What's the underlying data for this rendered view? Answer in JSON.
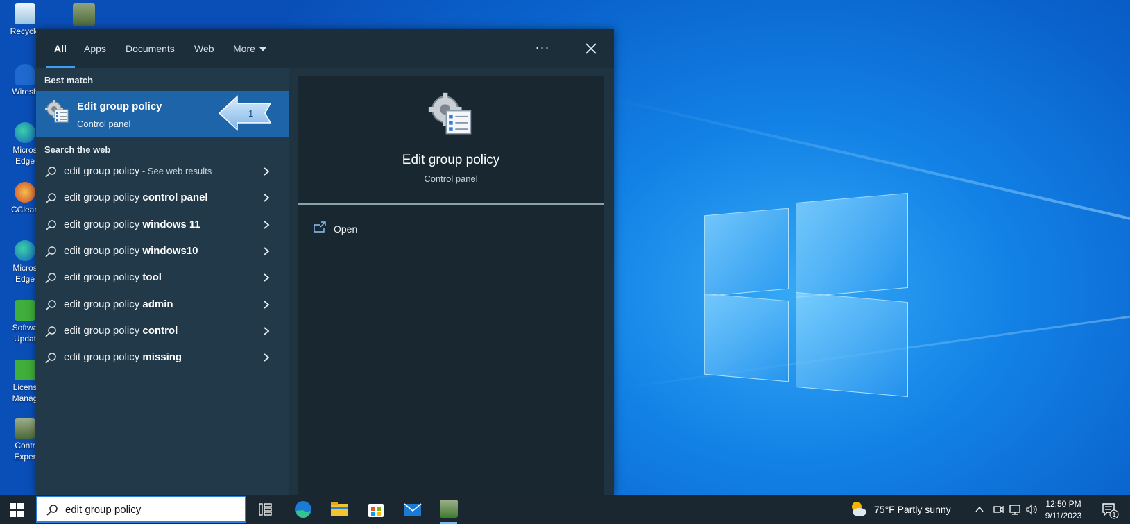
{
  "desktop": {
    "icons": [
      {
        "label": "Recycle",
        "color": "#cfe6f7"
      },
      {
        "label": "Wiresh",
        "color": "#1e6ad0"
      },
      {
        "label": "Micros Edge",
        "color": "#1fa57a"
      },
      {
        "label": "CClean",
        "color": "#d2452d"
      },
      {
        "label": "Micros Edge",
        "color": "#1fa57a"
      },
      {
        "label": "Softwa Updat",
        "color": "#3fae3a"
      },
      {
        "label": "Licens Manag",
        "color": "#3fae3a"
      },
      {
        "label": "Contr Exper",
        "color": "#6b8a5a"
      }
    ]
  },
  "start_menu": {
    "tabs": [
      {
        "label": "All",
        "active": true
      },
      {
        "label": "Apps"
      },
      {
        "label": "Documents"
      },
      {
        "label": "Web"
      },
      {
        "label": "More"
      }
    ],
    "more_icon": "ellipsis-icon",
    "close_icon": "close-icon",
    "best_match_header": "Best match",
    "best_match": {
      "title": "Edit group policy",
      "subtitle": "Control panel",
      "icon": "group-policy-icon",
      "callout_number": "1"
    },
    "web_header": "Search the web",
    "web_results": [
      {
        "prefix": "edit group policy",
        "suffix": "",
        "hint": " - See web results"
      },
      {
        "prefix": "edit group policy ",
        "suffix": "control panel",
        "hint": ""
      },
      {
        "prefix": "edit group policy ",
        "suffix": "windows 11",
        "hint": ""
      },
      {
        "prefix": "edit group policy ",
        "suffix": "windows10",
        "hint": ""
      },
      {
        "prefix": "edit group policy ",
        "suffix": "tool",
        "hint": ""
      },
      {
        "prefix": "edit group policy ",
        "suffix": "admin",
        "hint": ""
      },
      {
        "prefix": "edit group policy ",
        "suffix": "control",
        "hint": ""
      },
      {
        "prefix": "edit group policy ",
        "suffix": "missing",
        "hint": ""
      }
    ],
    "preview": {
      "title": "Edit group policy",
      "subtitle": "Control panel",
      "action_label": "Open"
    }
  },
  "taskbar": {
    "search_value": "edit group policy",
    "apps": [
      "task-view-icon",
      "edge-icon",
      "file-explorer-icon",
      "store-icon",
      "mail-icon",
      "control-app-icon"
    ],
    "weather": "75°F  Partly sunny",
    "time": "12:50 PM",
    "date": "9/11/2023",
    "notification_count": "1"
  },
  "colors": {
    "accent": "#3d9ff5",
    "selected_row": "#1e64a8",
    "menu_bg": "#22394a",
    "preview_bg": "#192730"
  }
}
